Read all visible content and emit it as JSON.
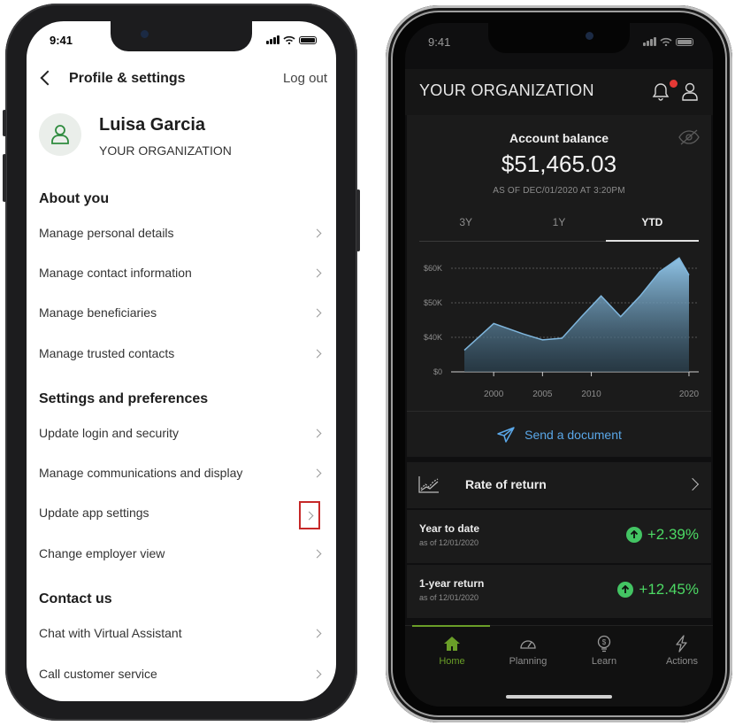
{
  "phone1": {
    "status_time": "9:41",
    "header": {
      "title": "Profile & settings",
      "logout": "Log out"
    },
    "profile": {
      "name": "Luisa Garcia",
      "org": "YOUR ORGANIZATION"
    },
    "sections": {
      "about": "About you",
      "settings": "Settings and preferences",
      "contact": "Contact us"
    },
    "about_items": [
      "Manage personal details",
      "Manage contact information",
      "Manage beneficiaries",
      "Manage trusted contacts"
    ],
    "settings_items": [
      "Update login and security",
      "Manage communications and display",
      "Update app settings",
      "Change employer view"
    ],
    "contact_items": [
      "Chat with Virtual Assistant",
      "Call customer service"
    ],
    "highlighted_item": "Update app settings",
    "highlight_color": "#c62828"
  },
  "phone2": {
    "status_time": "9:41",
    "org": "YOUR ORGANIZATION",
    "balance": {
      "label": "Account balance",
      "amount": "$51,465.03",
      "as_of": "AS OF DEC/01/2020 AT 3:20PM"
    },
    "tabs": [
      "3Y",
      "1Y",
      "YTD"
    ],
    "active_tab": "YTD",
    "send_document": "Send a document",
    "rate_of_return": "Rate of return",
    "returns": [
      {
        "title": "Year to date",
        "sub": "as of 12/01/2020",
        "value": "+2.39%"
      },
      {
        "title": "1-year return",
        "sub": "as of 12/01/2020",
        "value": "+12.45%"
      }
    ],
    "nav": [
      "Home",
      "Planning",
      "Learn",
      "Actions"
    ],
    "active_nav": "Home",
    "colors": {
      "positive": "#4cd964",
      "accent_link": "#5aa7e8",
      "nav_active": "#6a9e28",
      "notification": "#e53935"
    }
  },
  "chart_data": {
    "type": "area",
    "x": [
      1997,
      2000,
      2003,
      2005,
      2007,
      2009,
      2011,
      2013,
      2015,
      2017,
      2019,
      2020
    ],
    "y": [
      25,
      44,
      41,
      37,
      39,
      46,
      52,
      46,
      52,
      59,
      63,
      58,
      67
    ],
    "xticks": [
      "2000",
      "2005",
      "2010",
      "2020"
    ],
    "xtick_values": [
      2000,
      2005,
      2010,
      2020
    ],
    "yticks": [
      "$0",
      "$40K",
      "$50K",
      "$60K"
    ],
    "ylim": [
      0,
      80
    ],
    "xlim": [
      1996,
      2021
    ],
    "grid": true
  }
}
